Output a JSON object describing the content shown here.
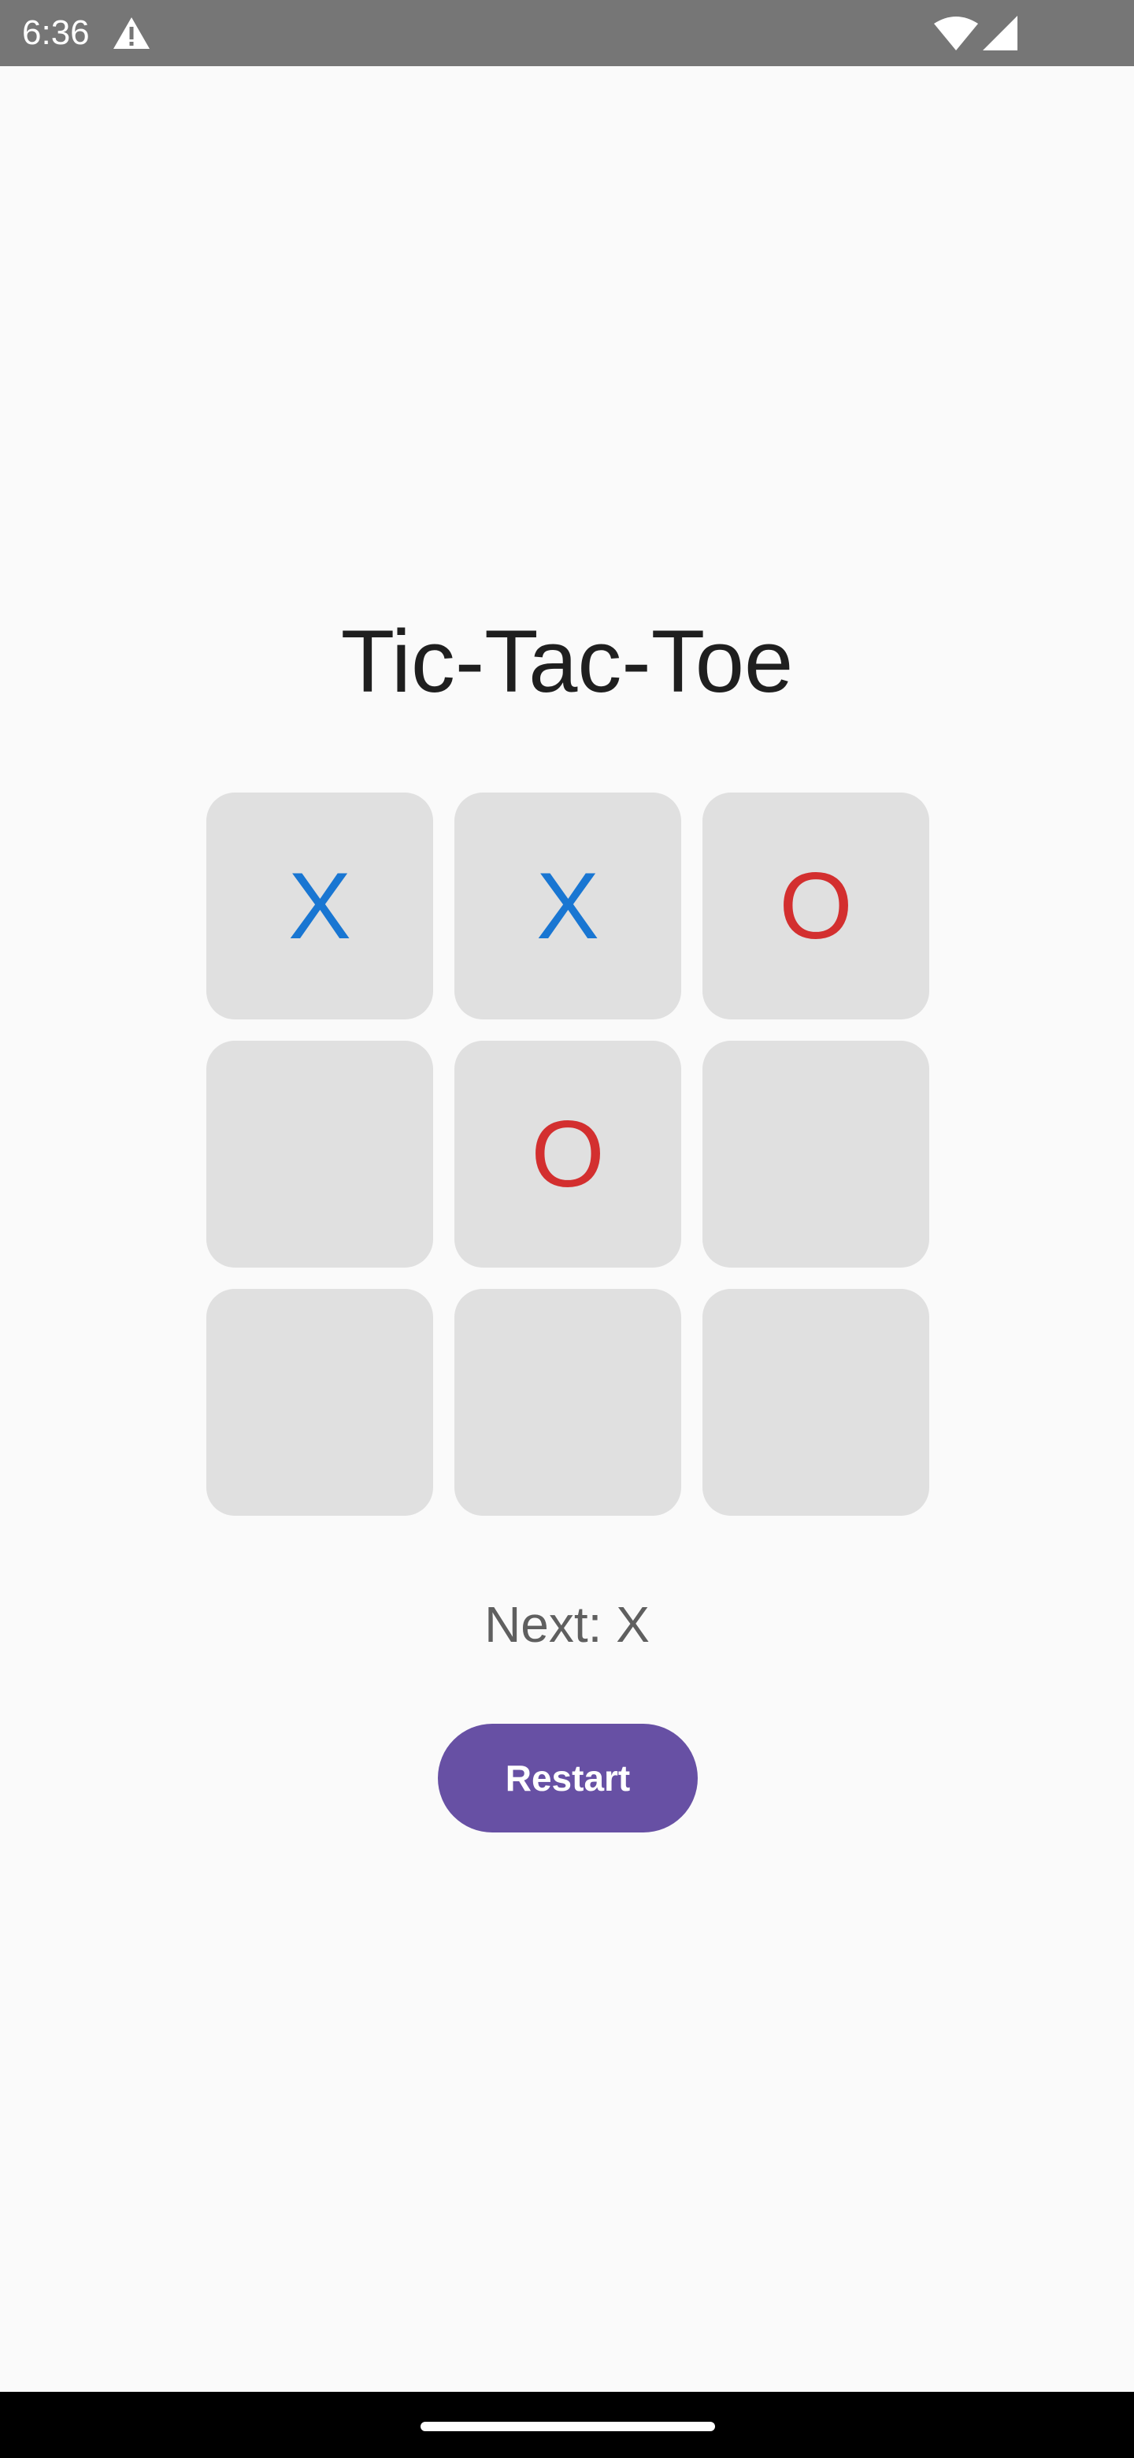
{
  "status_bar": {
    "time": "6:36",
    "icons": [
      "warning-icon",
      "wifi-icon",
      "signal-icon"
    ]
  },
  "app": {
    "title": "Tic-Tac-Toe"
  },
  "board": {
    "cells": [
      "X",
      "X",
      "O",
      "",
      "O",
      "",
      "",
      "",
      ""
    ]
  },
  "status": {
    "next_text": "Next: X"
  },
  "controls": {
    "restart_label": "Restart"
  },
  "colors": {
    "x_color": "#1976D2",
    "o_color": "#D32F2F",
    "cell_bg": "#E0E0E0",
    "button_bg": "#6750A4",
    "status_bar_bg": "#767676"
  }
}
